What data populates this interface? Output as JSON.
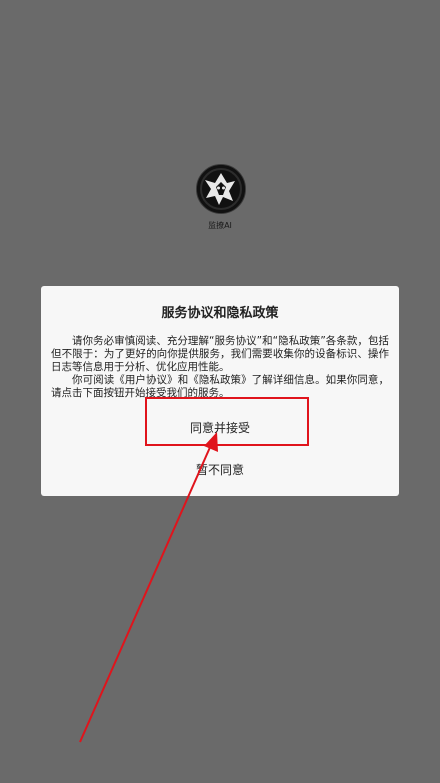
{
  "app": {
    "name": "监撩AI"
  },
  "dialog": {
    "title": "服务协议和隐私政策",
    "paragraph_1": "请你务必审慎阅读、充分理解“服务协议”和“隐私政策”各条款，包括但不限于：为了更好的向你提供服务，我们需要收集你的设备标识、操作日志等信息用于分析、优化应用性能。",
    "paragraph_2": "你可阅读《用户协议》和《隐私政策》了解详细信息。如果你同意，请点击下面按钮开始接受我们的服务。",
    "accept_label": "同意并接受",
    "decline_label": "暂不同意"
  },
  "colors": {
    "backdrop": "#6a6a6a",
    "dialog_bg": "#f7f7f7",
    "annotation_red": "#e0141c"
  },
  "icons": {
    "logo": "app-logo-icon",
    "arrow": "annotation-arrow"
  }
}
